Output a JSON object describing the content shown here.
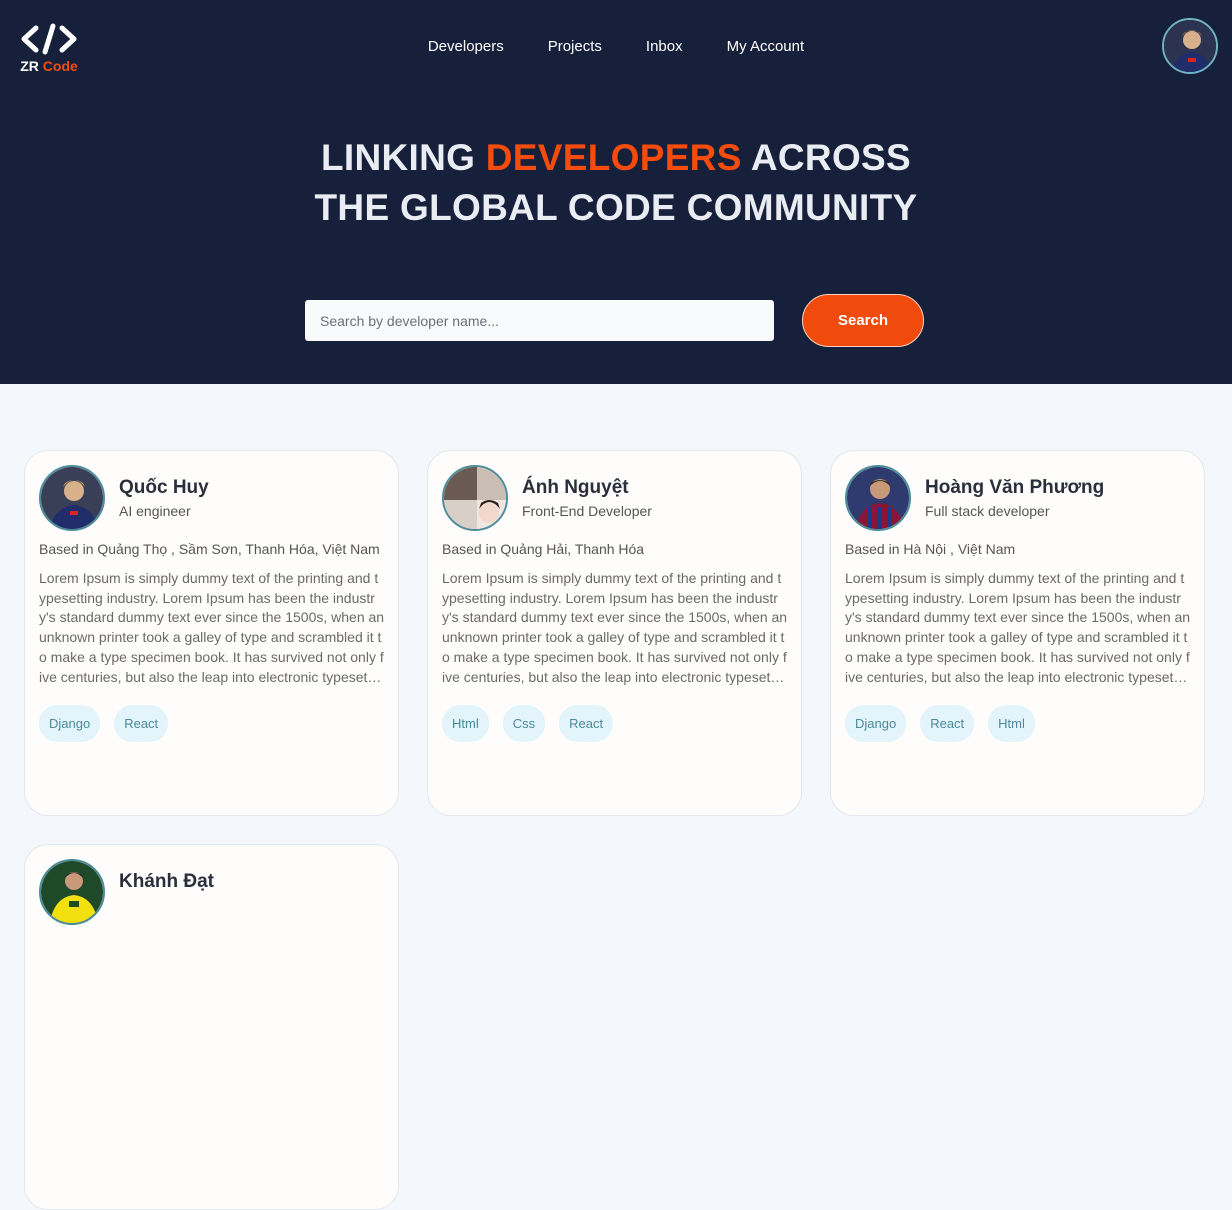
{
  "logo": {
    "text_prefix": "ZR ",
    "text_accent": "Code"
  },
  "nav": {
    "items": [
      "Developers",
      "Projects",
      "Inbox",
      "My Account"
    ]
  },
  "headline": {
    "line1_pre": "LINKING ",
    "line1_accent": "DEVELOPERS",
    "line1_post": " ACROSS",
    "line2": "THE GLOBAL CODE COMMUNITY"
  },
  "search": {
    "placeholder": "Search by developer name...",
    "value": "",
    "button_label": "Search"
  },
  "colors": {
    "header_bg": "#16203a",
    "accent": "#f04a0c",
    "tag_bg": "#e3f5fb",
    "tag_text": "#4b8a9c"
  },
  "developers": [
    {
      "name": "Quốc Huy",
      "role": "AI engineer",
      "location": "Based in Quảng Thọ , Sầm Sơn, Thanh Hóa, Việt Nam",
      "bio": "Lorem Ipsum is simply dummy text of the printing and typesetting industry. Lorem Ipsum has been the industry's standard dummy text ever since the 1500s, when an unknown printer took a galley of type and scrambled it to make a type specimen book. It has survived not only five centuries, but also the leap into electronic typeset…",
      "tags": [
        "Django",
        "React"
      ]
    },
    {
      "name": "Ánh Nguyệt",
      "role": "Front-End Developer",
      "location": "Based in Quảng Hải, Thanh Hóa",
      "bio": "Lorem Ipsum is simply dummy text of the printing and typesetting industry. Lorem Ipsum has been the industry's standard dummy text ever since the 1500s, when an unknown printer took a galley of type and scrambled it to make a type specimen book. It has survived not only five centuries, but also the leap into electronic typeset…",
      "tags": [
        "Html",
        "Css",
        "React"
      ]
    },
    {
      "name": "Hoàng Văn Phương",
      "role": "Full stack developer",
      "location": "Based in Hà Nội , Việt Nam",
      "bio": "Lorem Ipsum is simply dummy text of the printing and typesetting industry. Lorem Ipsum has been the industry's standard dummy text ever since the 1500s, when an unknown printer took a galley of type and scrambled it to make a type specimen book. It has survived not only five centuries, but also the leap into electronic typeset…",
      "tags": [
        "Django",
        "React",
        "Html"
      ]
    },
    {
      "name": "Khánh Đạt",
      "role": "",
      "location": "",
      "bio": "",
      "tags": []
    }
  ]
}
